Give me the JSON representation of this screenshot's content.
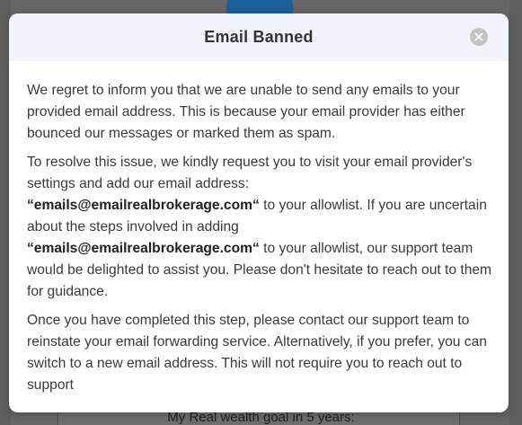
{
  "background": {
    "partial_text": "My Real wealth goal in 5 years:"
  },
  "modal": {
    "title": "Email Banned",
    "close_icon": "close-icon",
    "paragraph1": "We regret to inform you that we are unable to send any emails to your provided email address. This is because your email provider has either bounced our messages or marked them as spam.",
    "paragraph2": {
      "intro": "To resolve this issue, we kindly request you to visit your email provider's settings and add our email address:",
      "email1": "“emails@emailrealbrokerage.com“",
      "middle": " to your allowlist. If you are uncertain about the steps involved in adding",
      "email2": "“emails@emailrealbrokerage.com“",
      "outro": " to your allowlist, our support team would be delighted to assist you. Please don't hesitate to reach out to them for guidance."
    },
    "paragraph3": "Once you have completed this step, please contact our support team to reinstate your email forwarding service. Alternatively, if you prefer, you can switch to a new email address. This will not require you to reach out to support"
  },
  "colors": {
    "overlay": "#666666",
    "header_bg": "#f1f5fb",
    "close_bg": "#c4c4c4",
    "avatar": "#1d5f9a"
  }
}
